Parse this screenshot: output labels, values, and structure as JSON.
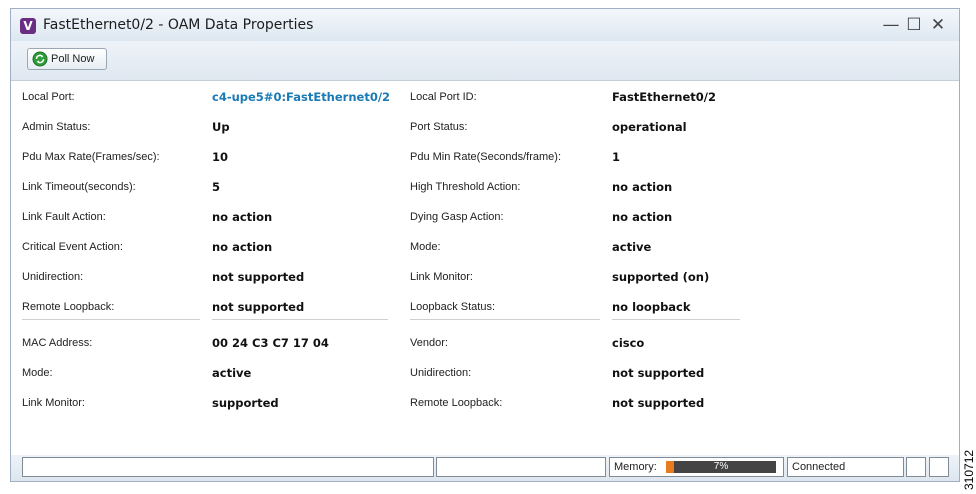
{
  "window": {
    "title": "FastEthernet0/2 - OAM Data Properties",
    "icon_letter": "V",
    "minimize": "—",
    "maximize": "☐",
    "close": "✕"
  },
  "toolbar": {
    "poll_label": "Poll Now",
    "poll_icon": "refresh-icon"
  },
  "rows": [
    {
      "l1": "Local Port:",
      "v1": "c4-upe5#0:FastEthernet0/2",
      "l2": "Local Port ID:",
      "v2": "FastEthernet0/2"
    },
    {
      "l1": "Admin Status:",
      "v1": "Up",
      "l2": "Port Status:",
      "v2": "operational"
    },
    {
      "l1": "Pdu Max Rate(Frames/sec):",
      "v1": "10",
      "l2": "Pdu Min Rate(Seconds/frame):",
      "v2": "1"
    },
    {
      "l1": "Link Timeout(seconds):",
      "v1": "5",
      "l2": "High Threshold Action:",
      "v2": "no action"
    },
    {
      "l1": "Link Fault Action:",
      "v1": "no action",
      "l2": "Dying Gasp Action:",
      "v2": "no action"
    },
    {
      "l1": "Critical Event Action:",
      "v1": "no action",
      "l2": "Mode:",
      "v2": "active"
    },
    {
      "l1": "Unidirection:",
      "v1": "not supported",
      "l2": "Link Monitor:",
      "v2": "supported (on)"
    },
    {
      "l1": "Remote Loopback:",
      "v1": "not supported",
      "l2": "Loopback Status:",
      "v2": "no loopback"
    },
    {
      "l1": "MAC Address:",
      "v1": "00 24 C3 C7 17 04",
      "l2": "Vendor:",
      "v2": "cisco"
    },
    {
      "l1": "Mode:",
      "v1": "active",
      "l2": "Unidirection:",
      "v2": "not supported"
    },
    {
      "l1": "Link Monitor:",
      "v1": "supported",
      "l2": "Remote Loopback:",
      "v2": "not supported"
    }
  ],
  "statusbar": {
    "memory_label": "Memory:",
    "memory_percent": "7%",
    "memory_fraction": 0.07,
    "connection": "Connected"
  },
  "figure_id": "310712",
  "colors": {
    "link": "#1a7ab4",
    "memory_fill": "#e87b1e",
    "app_icon": "#6b2d84"
  }
}
